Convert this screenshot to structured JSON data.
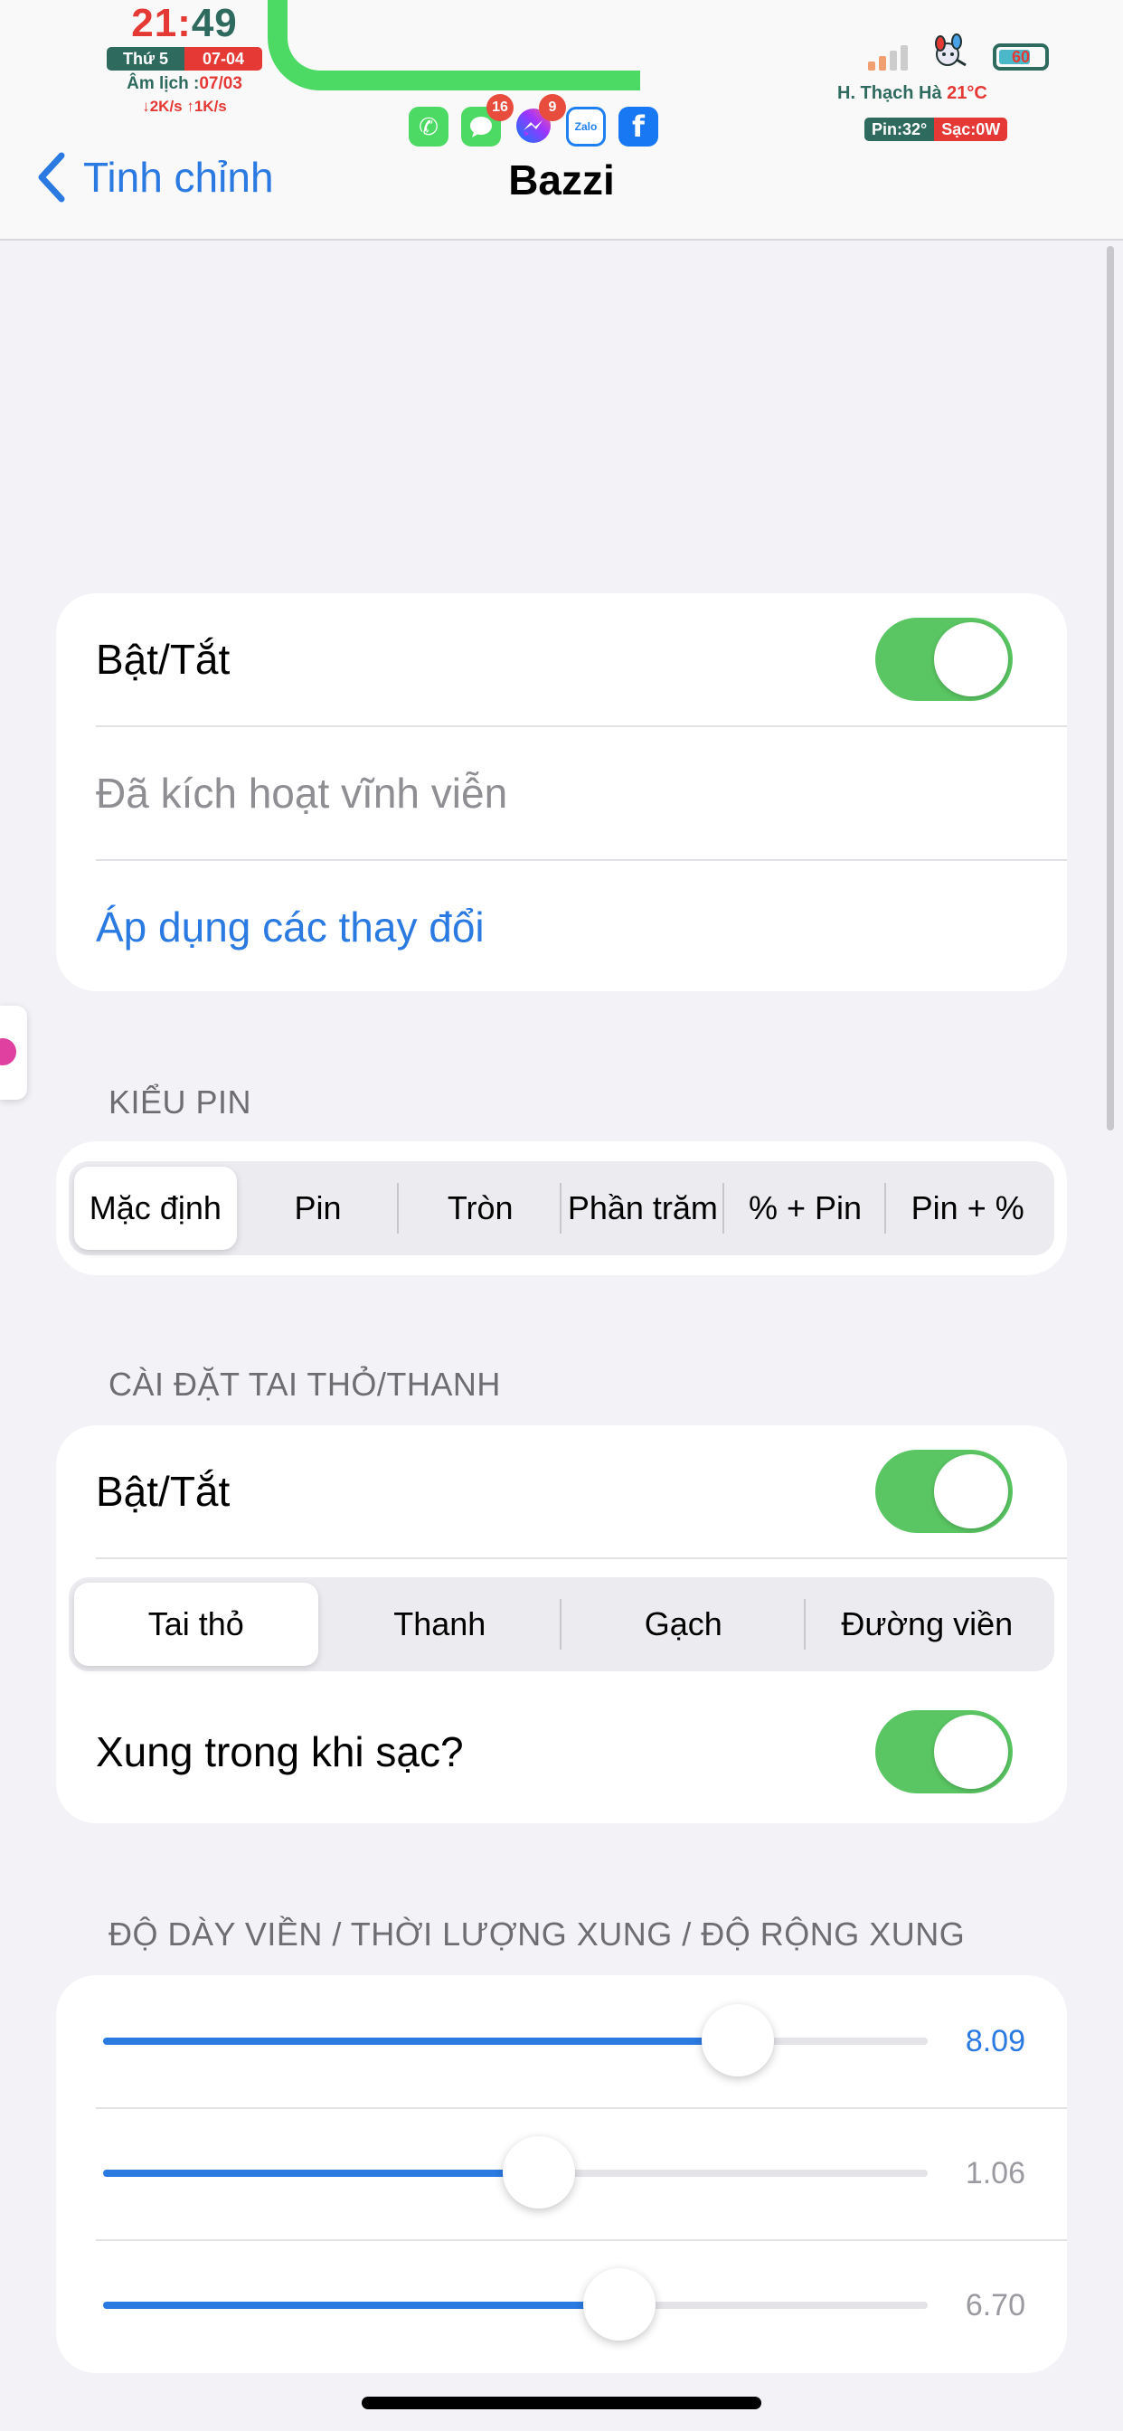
{
  "status": {
    "clock_hh": "21",
    "clock_mm": "49",
    "day_of_week": "Thứ 5",
    "date": "07-04",
    "lunar_label": "Âm lịch :",
    "lunar_date": "07/03",
    "net_speed": "↓2K/s ↑1K/s",
    "apps": [
      {
        "name": "phone",
        "badge": ""
      },
      {
        "name": "messages",
        "badge": "16"
      },
      {
        "name": "messenger",
        "badge": "9"
      },
      {
        "name": "zalo",
        "badge": "",
        "text": "Zalo"
      },
      {
        "name": "facebook",
        "badge": "",
        "text": "f"
      }
    ],
    "location": "H. Thạch Hà",
    "temperature": "21°C",
    "battery_level": "60",
    "battery_temp": "Pin:32°",
    "charge": "Sạc:0W"
  },
  "nav": {
    "back_label": "Tinh chỉnh",
    "title": "Bazzi"
  },
  "main_card": {
    "toggle_label": "Bật/Tắt",
    "toggle_on": true,
    "status_text": "Đã kích hoạt vĩnh viễn",
    "apply_link": "Áp dụng các thay đổi"
  },
  "battery_style": {
    "section_title": "KIỂU PIN",
    "options": [
      "Mặc định",
      "Pin",
      "Tròn",
      "Phần trăm",
      "% + Pin",
      "Pin + %"
    ],
    "selected_index": 0
  },
  "notch": {
    "section_title": "CÀI ĐẶT TAI THỎ/THANH",
    "toggle_label": "Bật/Tắt",
    "toggle_on": true,
    "options": [
      "Tai thỏ",
      "Thanh",
      "Gạch",
      "Đường viền"
    ],
    "selected_index": 0,
    "pulse_label": "Xung trong khi sạc?",
    "pulse_on": true
  },
  "sliders": {
    "section_title": "ĐỘ DÀY VIỀN / THỜI LƯỢNG XUNG / ĐỘ RỘNG XUNG",
    "items": [
      {
        "value": "8.09",
        "fraction": 0.77,
        "active": true
      },
      {
        "value": "1.06",
        "fraction": 0.528,
        "active": false
      },
      {
        "value": "6.70",
        "fraction": 0.626,
        "active": false
      }
    ]
  },
  "colors": {
    "accent": "#2a7ae2",
    "toggle_on": "#5ac663",
    "clock_red": "#e53935",
    "clock_green": "#2e6b5e"
  }
}
